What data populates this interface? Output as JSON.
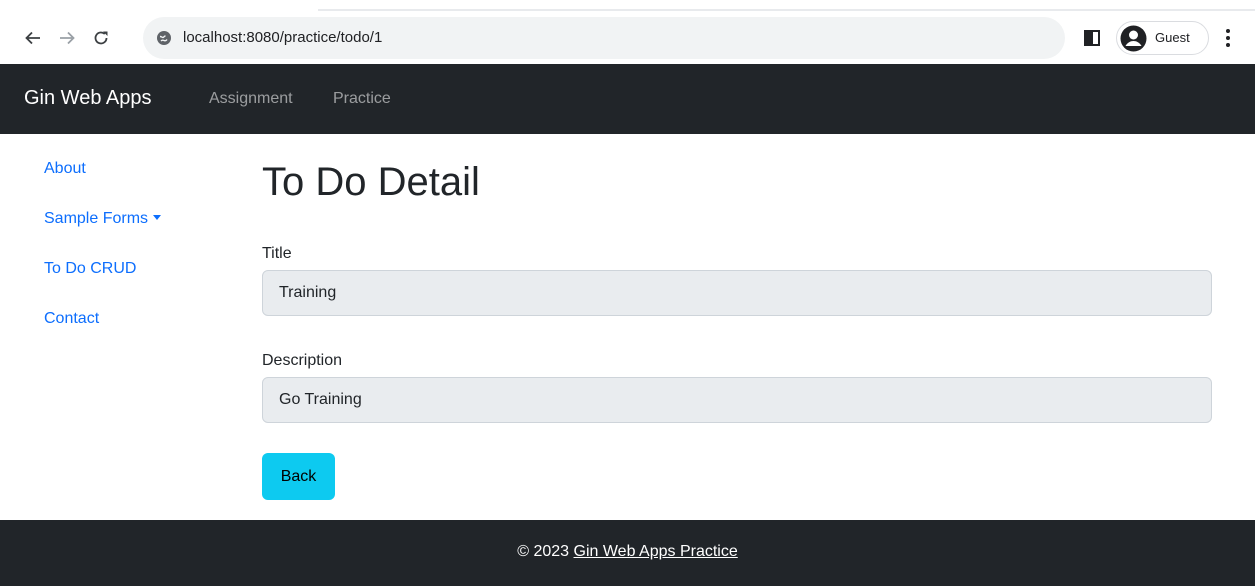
{
  "browser": {
    "url": "localhost:8080/practice/todo/1",
    "profile_label": "Guest"
  },
  "navbar": {
    "brand": "Gin Web Apps",
    "links": [
      {
        "label": "Assignment"
      },
      {
        "label": "Practice"
      }
    ]
  },
  "sidebar": {
    "items": [
      {
        "label": "About"
      },
      {
        "label": "Sample Forms"
      },
      {
        "label": "To Do CRUD"
      },
      {
        "label": "Contact"
      }
    ]
  },
  "main": {
    "title": "To Do Detail",
    "fields": [
      {
        "label": "Title",
        "value": "Training"
      },
      {
        "label": "Description",
        "value": "Go Training"
      }
    ],
    "back_label": "Back"
  },
  "footer": {
    "prefix": "© 2023 ",
    "link_label": "Gin Web Apps Practice"
  },
  "colors": {
    "navbar_bg": "#212529",
    "link": "#0d6efd",
    "button_info": "#0dcaf0",
    "input_disabled_bg": "#e9ecef"
  }
}
